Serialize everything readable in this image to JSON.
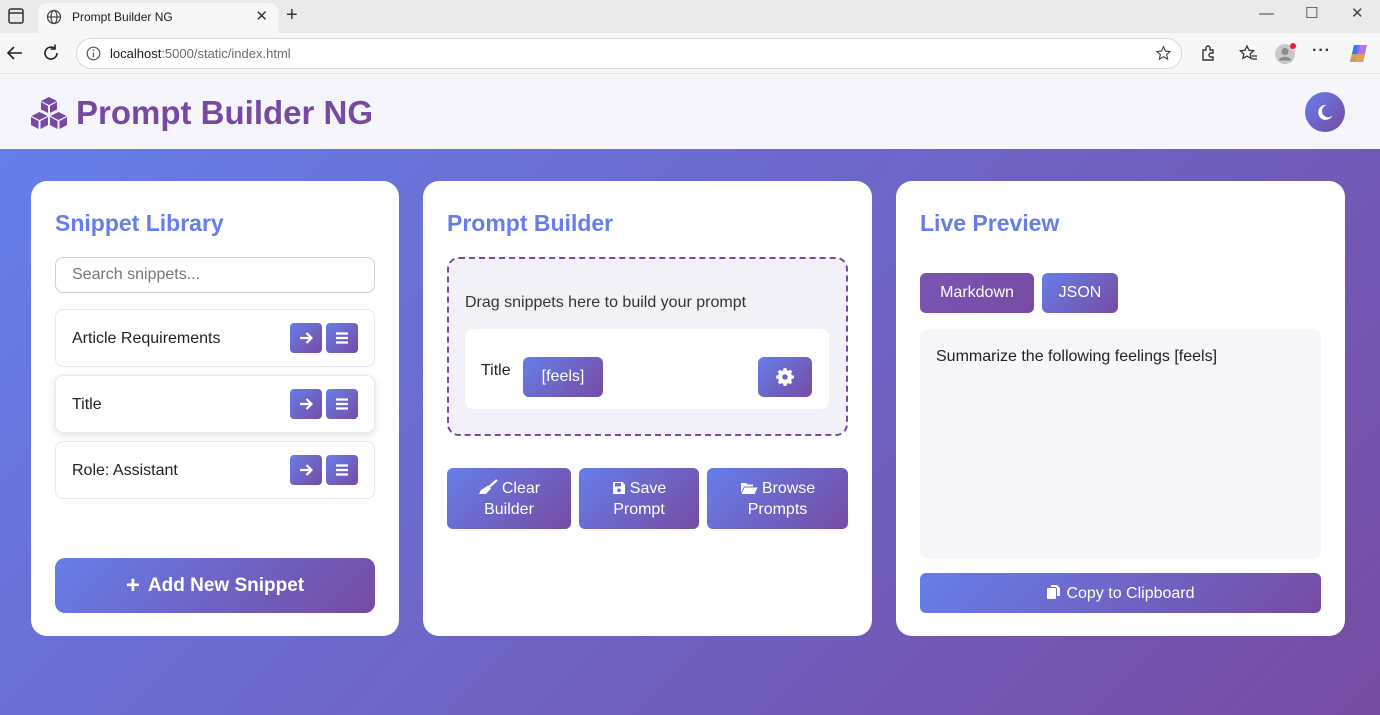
{
  "browser": {
    "tab_title": "Prompt Builder NG",
    "url_host": "localhost",
    "url_rest": ":5000/static/index.html"
  },
  "app": {
    "title": "Prompt Builder NG",
    "theme_toggle_icon": "moon-icon"
  },
  "library": {
    "title": "Snippet Library",
    "search_placeholder": "Search snippets...",
    "snippets": [
      {
        "name": "Article Requirements"
      },
      {
        "name": "Title"
      },
      {
        "name": "Role: Assistant"
      }
    ],
    "add_button": "Add New Snippet"
  },
  "builder": {
    "title": "Prompt Builder",
    "drop_hint": "Drag snippets here to build your prompt",
    "items": [
      {
        "label": "Title",
        "variable": "[feels]"
      }
    ],
    "clear_button": [
      "Clear",
      "Builder"
    ],
    "save_button": [
      "Save",
      "Prompt"
    ],
    "browse_button": [
      "Browse",
      "Prompts"
    ]
  },
  "preview": {
    "title": "Live Preview",
    "tabs": [
      "Markdown",
      "JSON"
    ],
    "active_tab": "Markdown",
    "text": "Summarize the following feelings [feels]",
    "copy_button": "Copy to Clipboard"
  },
  "colors": {
    "accent_start": "#667eea",
    "accent_end": "#764ba2",
    "title_purple": "#774aa2"
  }
}
